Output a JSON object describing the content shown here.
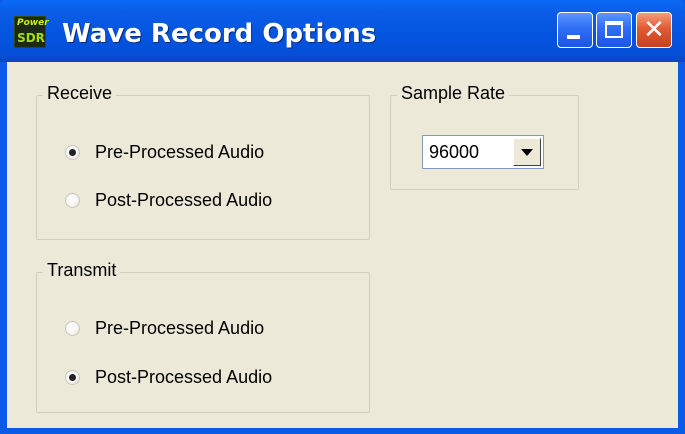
{
  "window": {
    "title": "Wave Record Options",
    "icon": {
      "name": "powersdr-icon",
      "line1": "Power",
      "line2": "SDR"
    },
    "buttons": [
      "minimize",
      "maximize",
      "close"
    ]
  },
  "receive": {
    "label": "Receive",
    "options": [
      {
        "label": "Pre-Processed Audio",
        "selected": true
      },
      {
        "label": "Post-Processed Audio",
        "selected": false
      }
    ]
  },
  "transmit": {
    "label": "Transmit",
    "options": [
      {
        "label": "Pre-Processed Audio",
        "selected": false
      },
      {
        "label": "Post-Processed Audio",
        "selected": true
      }
    ]
  },
  "sample_rate": {
    "label": "Sample Rate",
    "value": "96000"
  },
  "colors": {
    "titlebar": "#0454e0",
    "client": "#ece9d8",
    "close": "#e25a34"
  }
}
